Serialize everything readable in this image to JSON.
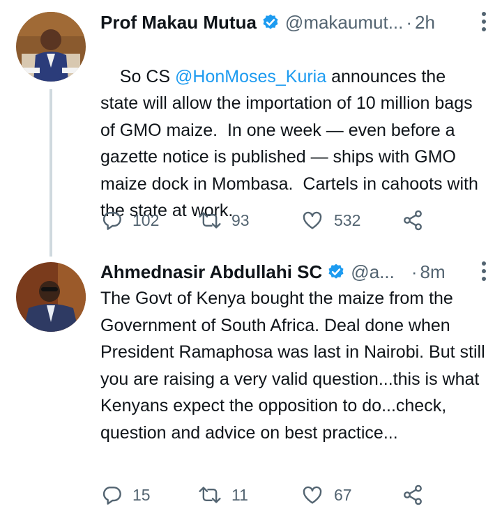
{
  "tweets": [
    {
      "author_name": "Prof Makau Mutua",
      "handle": "@makaumut...",
      "dot": "·",
      "time": "2h",
      "text_prefix": "So CS ",
      "mention": "@HonMoses_Kuria",
      "text_rest": " announces the state will allow the importation of 10 million bags of GMO maize.  In one week — even before a gazette notice is published — ships with GMO maize dock in Mombasa.  Cartels in cahoots with the state at work.",
      "replies": "102",
      "retweets": "93",
      "likes": "532"
    },
    {
      "author_name": "Ahmednasir Abdullahi SC",
      "handle": "@a...",
      "dot": "·",
      "time": "8m",
      "text": "The Govt of Kenya bought the maize from the Government of South Africa. Deal done when President Ramaphosa was last in Nairobi. But still you are raising a very valid question...this is what Kenyans expect the opposition to do...check, question and advice on best practice...",
      "replies": "15",
      "retweets": "11",
      "likes": "67"
    }
  ],
  "colors": {
    "accent": "#1d9bf0",
    "text": "#0f1419",
    "muted": "#536471",
    "thread_line": "#cfd9de"
  },
  "icons": [
    "verified-badge-icon",
    "more-icon",
    "reply-icon",
    "retweet-icon",
    "like-icon",
    "share-icon"
  ]
}
